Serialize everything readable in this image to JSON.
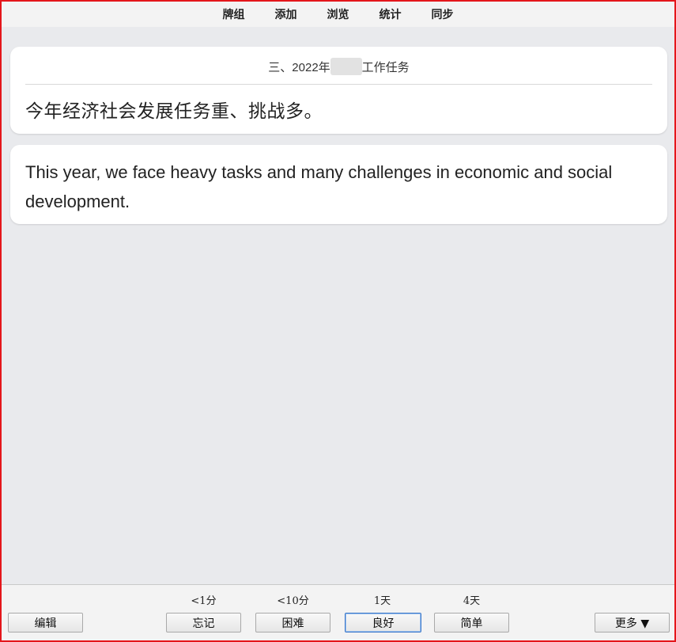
{
  "nav": {
    "items": [
      "牌组",
      "添加",
      "浏览",
      "统计",
      "同步"
    ]
  },
  "card": {
    "title_prefix": "三、2022年",
    "title_suffix": "工作任务",
    "question": "今年经济社会发展任务重、挑战多。",
    "answer": "This year, we face heavy tasks and many challenges in economic and social development."
  },
  "bottom": {
    "edit_label": "编辑",
    "more_label": "更多 ▼",
    "answers": [
      {
        "interval": "<1分",
        "label": "忘记"
      },
      {
        "interval": "<10分",
        "label": "困难"
      },
      {
        "interval": "1天",
        "label": "良好"
      },
      {
        "interval": "4天",
        "label": "简单"
      }
    ]
  },
  "colors": {
    "frame": "#e4161b",
    "background": "#e9eaed",
    "card": "#ffffff",
    "focus": "#3a77c9"
  }
}
